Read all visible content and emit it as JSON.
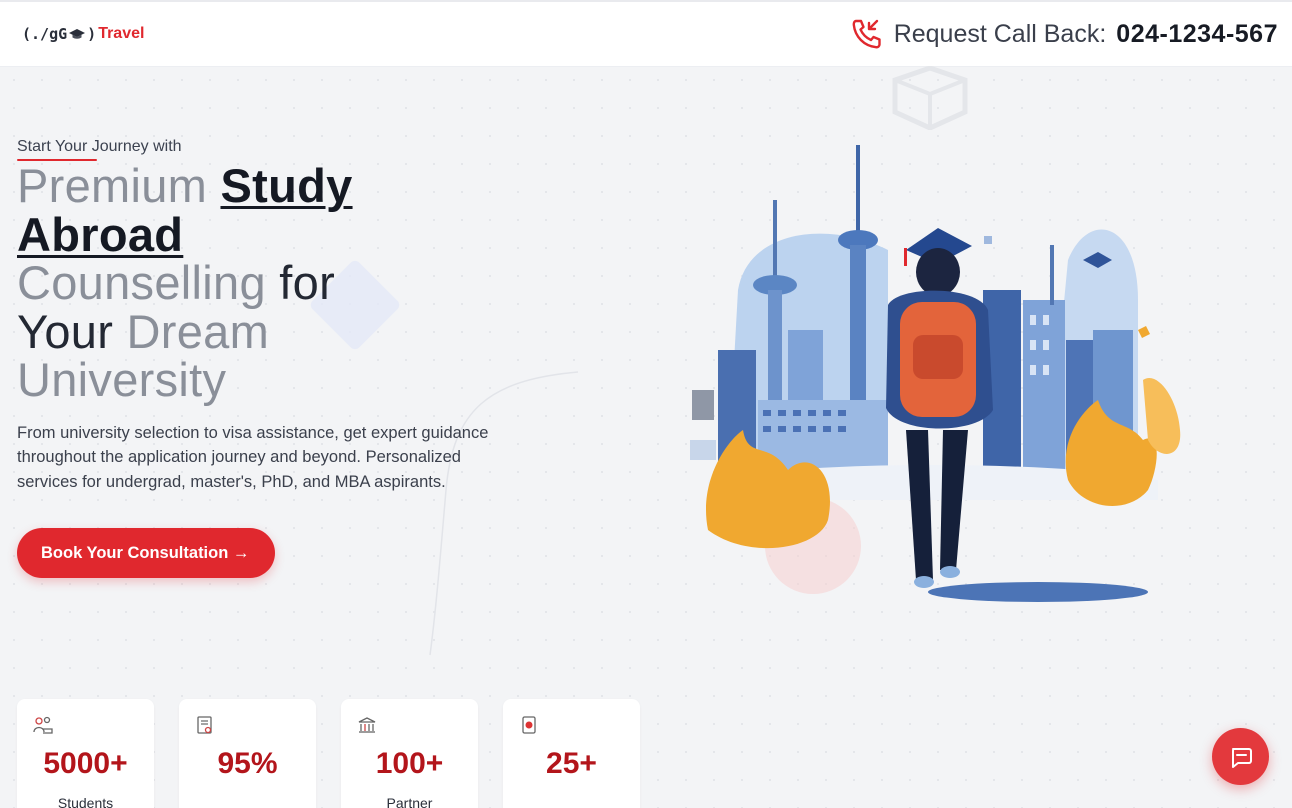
{
  "header": {
    "logo_prefix": "(./gG",
    "logo_suffix": ")",
    "logo_brand": "Travel",
    "callback_label": "Request Call Back:",
    "callback_number": "024-1234-567"
  },
  "hero": {
    "eyebrow": "Start Your Journey with",
    "headline": {
      "premium": "Premium",
      "study": "Study",
      "abroad": "Abroad",
      "counselling": "Counselling",
      "for": "for",
      "your": "Your",
      "dream": "Dream",
      "university": "University"
    },
    "description": "From university selection to visa assistance, get expert guidance throughout the application journey and beyond. Personalized services for undergrad, master's, PhD, and MBA aspirants.",
    "cta_label": "Book Your Consultation →"
  },
  "stats": [
    {
      "icon": "students-icon",
      "value": "5000+",
      "label": "Students"
    },
    {
      "icon": "certificate-icon",
      "value": "95%",
      "label": ""
    },
    {
      "icon": "university-icon",
      "value": "100+",
      "label": "Partner"
    },
    {
      "icon": "passport-icon",
      "value": "25+",
      "label": ""
    }
  ],
  "colors": {
    "accent": "#e0282e",
    "stat_value": "#b3151b",
    "background": "#f3f4f6"
  },
  "chat": {
    "icon": "chat-icon"
  }
}
